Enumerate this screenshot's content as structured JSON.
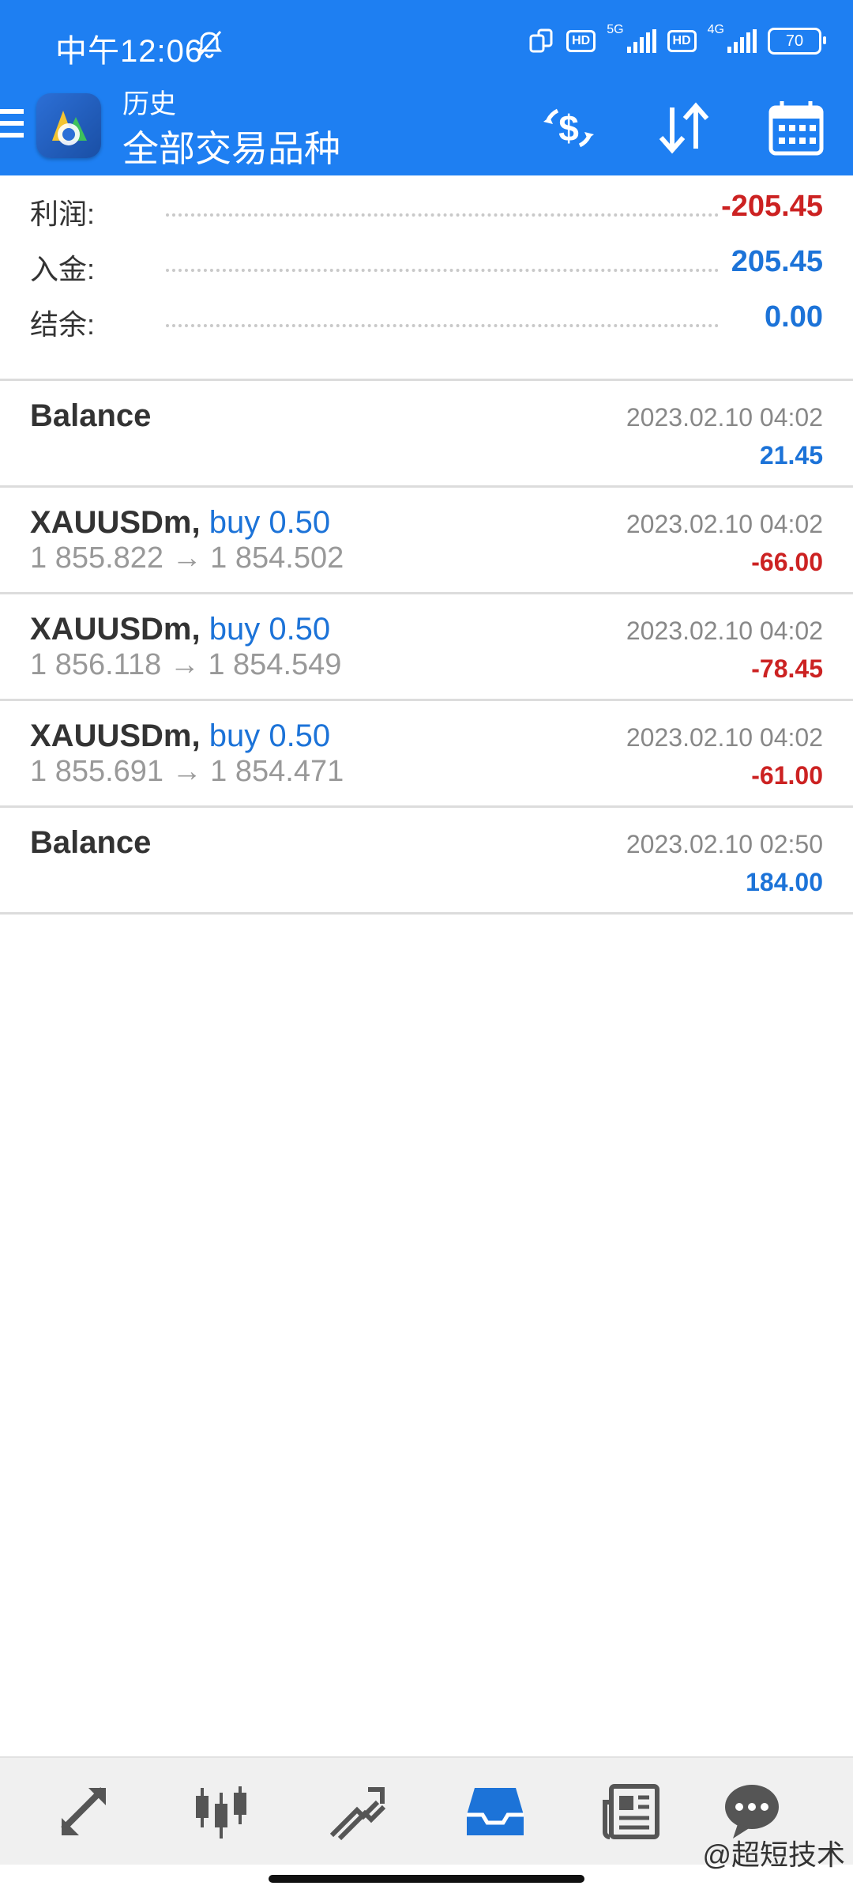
{
  "status_bar": {
    "time": "中午12:06",
    "network_1": "5G",
    "network_2": "4G",
    "hd_label": "HD",
    "battery": "70"
  },
  "app_bar": {
    "subtitle": "历史",
    "title": "全部交易品种",
    "icons": [
      "menu-icon",
      "app-logo",
      "currency-exchange-icon",
      "sort-icon",
      "calendar-icon"
    ]
  },
  "summary": {
    "profit_label": "利润:",
    "profit_value": "-205.45",
    "deposit_label": "入金:",
    "deposit_value": "205.45",
    "balance_label": "结余:",
    "balance_value": "0.00"
  },
  "history": [
    {
      "type": "balance",
      "title": "Balance",
      "date": "2023.02.10 04:02",
      "amount": "21.45",
      "amount_sign": "positive"
    },
    {
      "type": "trade",
      "symbol": "XAUUSDm,",
      "direction": "buy 0.50",
      "prices": "1 855.822 → 1 854.502",
      "date": "2023.02.10 04:02",
      "amount": "-66.00",
      "amount_sign": "negative"
    },
    {
      "type": "trade",
      "symbol": "XAUUSDm,",
      "direction": "buy 0.50",
      "prices": "1 856.118 → 1 854.549",
      "date": "2023.02.10 04:02",
      "amount": "-78.45",
      "amount_sign": "negative"
    },
    {
      "type": "trade",
      "symbol": "XAUUSDm,",
      "direction": "buy 0.50",
      "prices": "1 855.691 → 1 854.471",
      "date": "2023.02.10 04:02",
      "amount": "-61.00",
      "amount_sign": "negative"
    },
    {
      "type": "balance",
      "title": "Balance",
      "date": "2023.02.10 02:50",
      "amount": "184.00",
      "amount_sign": "positive"
    }
  ],
  "bottom_nav": {
    "items": [
      "quotes-icon",
      "chart-candles-icon",
      "trade-icon",
      "history-inbox-icon",
      "news-icon",
      "chat-icon"
    ],
    "active": "history-inbox-icon"
  },
  "watermark": "@超短技术",
  "colors": {
    "header_blue": "#1e7ff2",
    "negative": "#cc2222",
    "positive": "#1c73d8"
  }
}
